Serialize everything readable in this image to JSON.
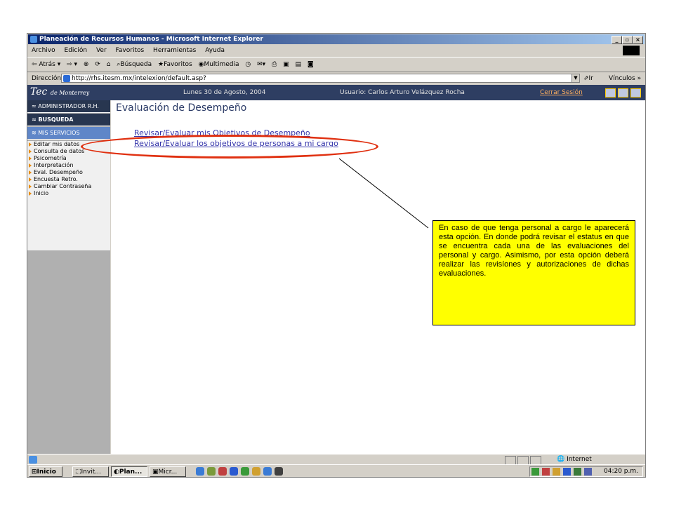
{
  "window": {
    "title": "Planeación de Recursos Humanos - Microsoft Internet Explorer"
  },
  "menu": [
    "Archivo",
    "Edición",
    "Ver",
    "Favoritos",
    "Herramientas",
    "Ayuda"
  ],
  "toolbar": {
    "back": "Atrás",
    "search": "Búsqueda",
    "favorites": "Favoritos",
    "multimedia": "Multimedia"
  },
  "address": {
    "label": "Dirección",
    "url": "http://rhs.itesm.mx/intelexion/default.asp?",
    "go": "Ir",
    "links": "Vínculos"
  },
  "header": {
    "brand": "Tec",
    "brand_sub": "de Monterrey",
    "date": "Lunes 30 de Agosto, 2004",
    "user": "Usuario: Carlos Arturo Velázquez Rocha",
    "logout": "Cerrar Sesión"
  },
  "sidebar": {
    "sections": [
      "ADMINISTRADOR R.H.",
      "BUSQUEDA",
      "MIS SERVICIOS"
    ],
    "items": [
      "Editar mis datos",
      "Consulta de datos",
      "Psicometría",
      "Interpretación",
      "Eval. Desempeño",
      "Encuesta Retro.",
      "Cambiar Contraseña",
      "Inicio"
    ]
  },
  "main": {
    "title": "Evaluación de Desempeño",
    "link1": "Revisar/Evaluar mis Objetivos de Desempeño",
    "link2": "Revisar/Evaluar los objetivos de personas a mi cargo"
  },
  "callout": "En caso de que tenga personal a cargo le aparecerá esta opción. En donde podrá revisar el estatus en que se encuentra cada una de las evaluaciones del personal y cargo. Asimismo, por esta opción deberá realizar las revisíones y autorizaciones de dichas evaluaciones.",
  "status": {
    "zone": "Internet"
  },
  "taskbar": {
    "start": "Inicio",
    "tasks": [
      "Invit...",
      "Plan...",
      "Micr..."
    ],
    "clock": "04:20 p.m."
  }
}
